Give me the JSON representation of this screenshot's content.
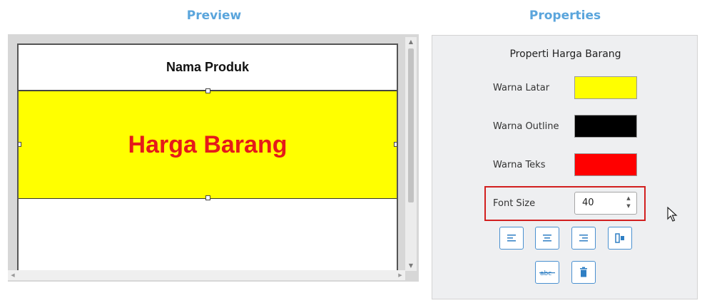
{
  "sections": {
    "preview_title": "Preview",
    "properties_title": "Properties"
  },
  "preview": {
    "name_label": "Nama Produk",
    "price_label": "Harga Barang"
  },
  "properties": {
    "heading": "Properti Harga Barang",
    "background_label": "Warna Latar",
    "background_color": "#ffff00",
    "outline_label": "Warna Outline",
    "outline_color": "#000000",
    "text_color_label": "Warna Teks",
    "text_color": "#ff0000",
    "font_size_label": "Font Size",
    "font_size_value": "40"
  },
  "toolbar_icons": {
    "align_left": "align-left-icon",
    "align_center": "align-center-icon",
    "align_right": "align-right-icon",
    "fit": "fit-width-icon",
    "strike": "strikethrough-icon",
    "delete": "trash-icon"
  }
}
